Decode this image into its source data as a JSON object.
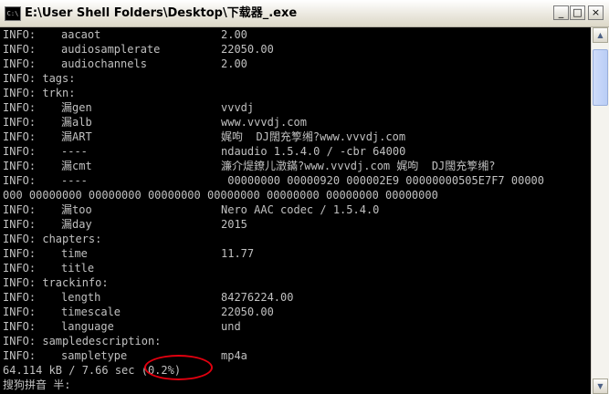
{
  "window": {
    "title": "E:\\User Shell Folders\\Desktop\\下载器_.exe",
    "icon_text": "C:\\",
    "buttons": {
      "minimize": "_",
      "maximize": "□",
      "close": "×"
    }
  },
  "console": {
    "lines": [
      {
        "c1": "INFO:",
        "c2": "aacaot",
        "c3": "2.00"
      },
      {
        "c1": "INFO:",
        "c2": "audiosamplerate",
        "c3": "22050.00"
      },
      {
        "c1": "INFO:",
        "c2": "audiochannels",
        "c3": "2.00"
      },
      {
        "c1": "INFO: tags:",
        "c2": "",
        "c3": ""
      },
      {
        "c1": "INFO: trkn:",
        "c2": "",
        "c3": ""
      },
      {
        "c1": "INFO:",
        "c2": "漏gen",
        "c3": "vvvdj"
      },
      {
        "c1": "INFO:",
        "c2": "漏alb",
        "c3": "www.vvvdj.com"
      },
      {
        "c1": "INFO:",
        "c2": "漏ART",
        "c3": "娓呴  DJ闊充箰缃?www.vvvdj.com"
      },
      {
        "c1": "INFO:",
        "c2": "----",
        "c3": "ndaudio 1.5.4.0 / -cbr 64000"
      },
      {
        "c1": "INFO:",
        "c2": "漏cmt",
        "c3": "濂介煶鐐儿澂鏋?www.vvvdj.com 娓呴  DJ闊充箰缃?"
      },
      {
        "c1": "INFO:",
        "c2": "----",
        "c3": " 00000000 00000920 000002E9 00000000505E7F7 00000"
      },
      {
        "c1": "000 00000000 00000000 00000000 00000000 00000000 00000000 00000000",
        "c2": "",
        "c3": ""
      },
      {
        "c1": "INFO:",
        "c2": "漏too",
        "c3": "Nero AAC codec / 1.5.4.0"
      },
      {
        "c1": "INFO:",
        "c2": "漏day",
        "c3": "2015"
      },
      {
        "c1": "INFO: chapters:",
        "c2": "",
        "c3": ""
      },
      {
        "c1": "INFO:",
        "c2": "time",
        "c3": "11.77"
      },
      {
        "c1": "INFO:",
        "c2": "title",
        "c3": ""
      },
      {
        "c1": "INFO: trackinfo:",
        "c2": "",
        "c3": ""
      },
      {
        "c1": "INFO:",
        "c2": "length",
        "c3": "84276224.00"
      },
      {
        "c1": "INFO:",
        "c2": "timescale",
        "c3": "22050.00"
      },
      {
        "c1": "INFO:",
        "c2": "language",
        "c3": "und"
      },
      {
        "c1": "INFO: sampledescription:",
        "c2": "",
        "c3": ""
      },
      {
        "c1": "INFO:",
        "c2": "sampletype",
        "c3": "mp4a"
      },
      {
        "c1": "64.114 kB / 7.66 sec (0.2%)",
        "c2": "",
        "c3": ""
      },
      {
        "c1": "搜狗拼音 半:",
        "c2": "",
        "c3": ""
      }
    ]
  },
  "colors": {
    "console_bg": "#000000",
    "console_text": "#c0c0c0",
    "highlight": "#e1000f"
  }
}
